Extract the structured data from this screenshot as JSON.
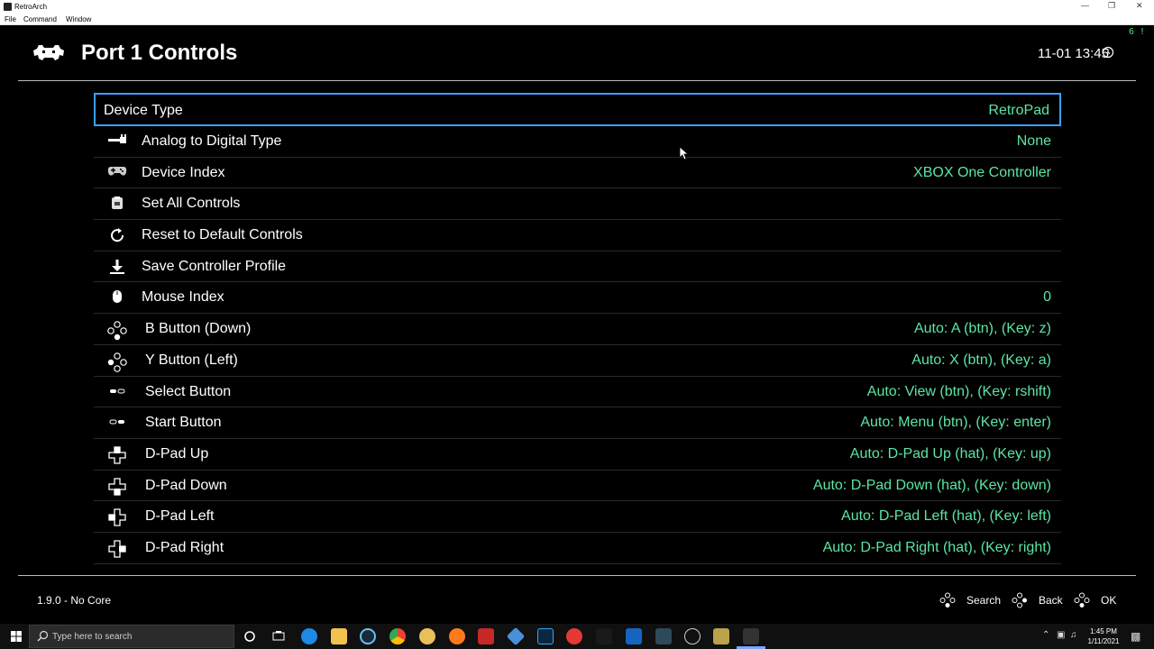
{
  "window": {
    "title": "RetroArch",
    "menu": [
      "File",
      "Command",
      "Window"
    ]
  },
  "header": {
    "fps": "6 !",
    "title": "Port 1 Controls",
    "clock": "11-01 13:45"
  },
  "rows": [
    {
      "label": "Device Type",
      "value": "RetroPad",
      "icon": "none"
    },
    {
      "label": "Analog to Digital Type",
      "value": "None",
      "icon": "analog-icon"
    },
    {
      "label": "Device Index",
      "value": "XBOX One Controller",
      "icon": "gamepad-icon"
    },
    {
      "label": "Set All Controls",
      "value": "",
      "icon": "clipboard-icon"
    },
    {
      "label": "Reset to Default Controls",
      "value": "",
      "icon": "reset-icon"
    },
    {
      "label": "Save Controller Profile",
      "value": "",
      "icon": "download-icon"
    },
    {
      "label": "Mouse Index",
      "value": "0",
      "icon": "mouse-icon"
    },
    {
      "label": "B Button (Down)",
      "value": "Auto:  A (btn), (Key: z)",
      "icon": "face-buttons-down-icon"
    },
    {
      "label": "Y Button (Left)",
      "value": "Auto:  X (btn), (Key: a)",
      "icon": "face-buttons-left-icon"
    },
    {
      "label": "Select Button",
      "value": "Auto:  View (btn), (Key: rshift)",
      "icon": "select-icon"
    },
    {
      "label": "Start Button",
      "value": "Auto:  Menu (btn), (Key: enter)",
      "icon": "start-icon"
    },
    {
      "label": "D-Pad Up",
      "value": "Auto:  D-Pad Up (hat), (Key: up)",
      "icon": "dpad-up-icon"
    },
    {
      "label": "D-Pad Down",
      "value": "Auto:  D-Pad Down (hat), (Key: down)",
      "icon": "dpad-down-icon"
    },
    {
      "label": "D-Pad Left",
      "value": "Auto:  D-Pad Left (hat), (Key: left)",
      "icon": "dpad-left-icon"
    },
    {
      "label": "D-Pad Right",
      "value": "Auto:  D-Pad Right (hat), (Key: right)",
      "icon": "dpad-right-icon"
    }
  ],
  "footer": {
    "version": "1.9.0 - No Core",
    "search": "Search",
    "back": "Back",
    "ok": "OK"
  },
  "taskbar": {
    "search_placeholder": "Type here to search",
    "time": "1:45 PM",
    "date": "1/11/2021"
  },
  "colors": {
    "value_green": "#5ce6a4",
    "selection_border": "#3aa0ff"
  }
}
